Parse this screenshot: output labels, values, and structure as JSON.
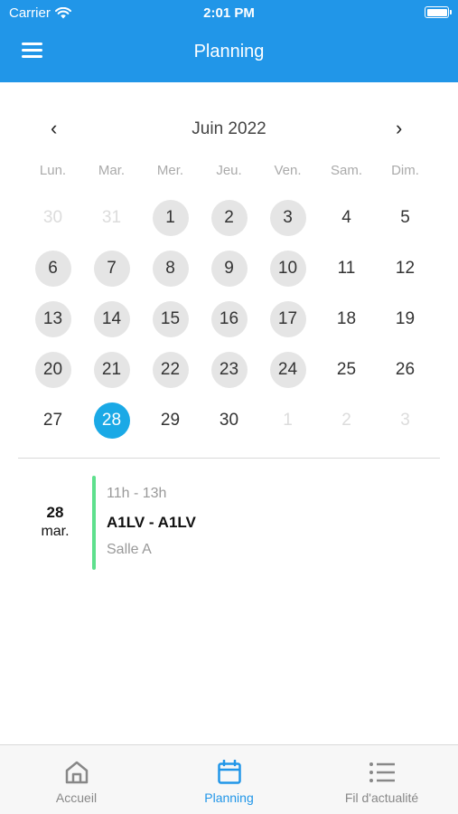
{
  "status_bar": {
    "carrier": "Carrier",
    "time": "2:01 PM"
  },
  "header": {
    "title": "Planning",
    "menu_icon": "hamburger-menu-icon"
  },
  "calendar": {
    "month_label": "Juin 2022",
    "prev_icon": "chevron-left-icon",
    "next_icon": "chevron-right-icon",
    "weekdays": [
      "Lun.",
      "Mar.",
      "Mer.",
      "Jeu.",
      "Ven.",
      "Sam.",
      "Dim."
    ],
    "weeks": [
      [
        "30",
        "31",
        "1",
        "2",
        "3",
        "4",
        "5"
      ],
      [
        "6",
        "7",
        "8",
        "9",
        "10",
        "11",
        "12"
      ],
      [
        "13",
        "14",
        "15",
        "16",
        "17",
        "18",
        "19"
      ],
      [
        "20",
        "21",
        "22",
        "23",
        "24",
        "25",
        "26"
      ],
      [
        "27",
        "28",
        "29",
        "30",
        "1",
        "2",
        "3"
      ]
    ],
    "selected_color": "#1aa9e6",
    "event_day_color": "#e5e5e5"
  },
  "event": {
    "day_number": "28",
    "day_of_week": "mar.",
    "time": "11h - 13h",
    "name": "A1LV - A1LV",
    "room": "Salle A",
    "accent_color": "#5ee08d"
  },
  "tabs": [
    {
      "label": "Accueil",
      "icon": "home-icon"
    },
    {
      "label": "Planning",
      "icon": "calendar-icon"
    },
    {
      "label": "Fil d'actualité",
      "icon": "list-icon"
    }
  ],
  "colors": {
    "primary": "#2196e8"
  }
}
